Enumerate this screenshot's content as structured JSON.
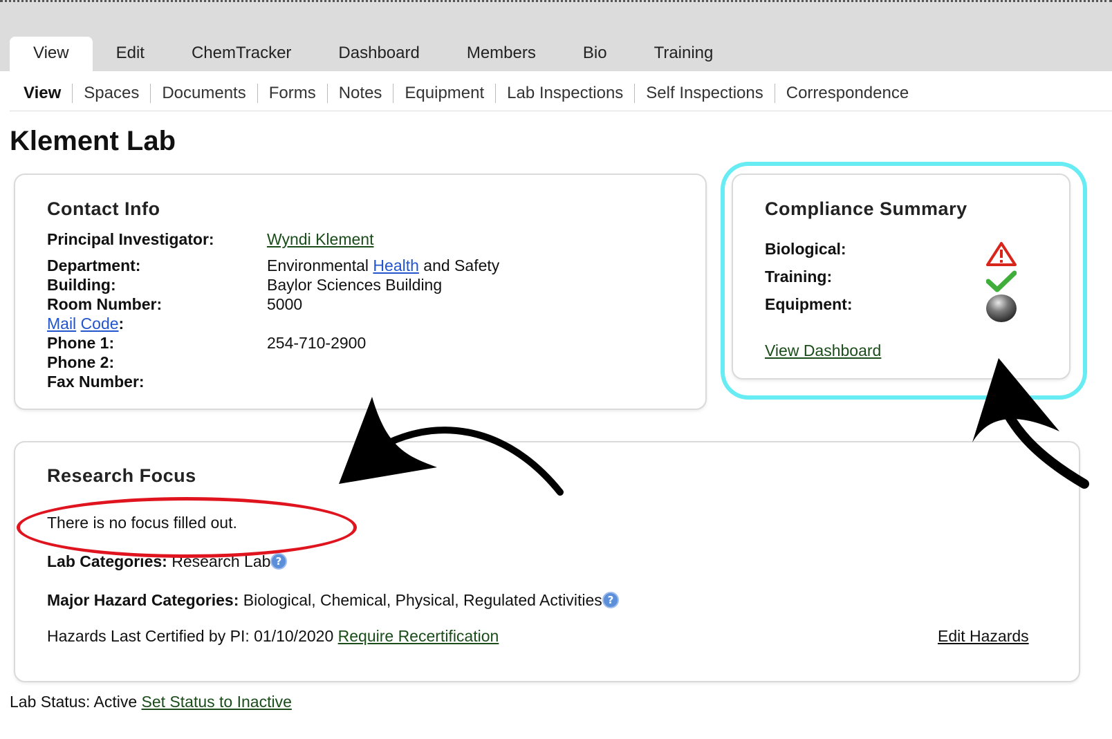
{
  "tabs": [
    {
      "label": "View",
      "active": true
    },
    {
      "label": "Edit"
    },
    {
      "label": "ChemTracker"
    },
    {
      "label": "Dashboard"
    },
    {
      "label": "Members"
    },
    {
      "label": "Bio"
    },
    {
      "label": "Training"
    }
  ],
  "subnav": [
    "View",
    "Spaces",
    "Documents",
    "Forms",
    "Notes",
    "Equipment",
    "Lab Inspections",
    "Self Inspections",
    "Correspondence"
  ],
  "page_title": "Klement Lab",
  "contact": {
    "title": "Contact Info",
    "pi_label": "Principal Investigator:",
    "pi_value": "Wyndi Klement",
    "department_label": "Department:",
    "department_value_1": "Environmental",
    "department_value_link": "Health",
    "department_value_2": "and Safety",
    "building_label": "Building:",
    "building_value": "Baylor Sciences Building",
    "room_label": "Room Number:",
    "room_value": "5000",
    "mail_label_1": "Mail",
    "mail_label_2": "Code",
    "mail_colon": ":",
    "phone1_label": "Phone 1:",
    "phone1_value": "254-710-2900",
    "phone2_label": "Phone 2:",
    "fax_label": "Fax Number:"
  },
  "compliance": {
    "title": "Compliance Summary",
    "biological_label": "Biological:",
    "biological_status": "warning-icon",
    "training_label": "Training:",
    "training_status": "check-icon",
    "equipment_label": "Equipment:",
    "equipment_status": "grey-circle-icon",
    "view_dashboard": "View Dashboard"
  },
  "research": {
    "title": "Research Focus",
    "focus_text": "There is no focus filled out.",
    "lab_categories_label": "Lab Categories:",
    "lab_categories_value": "Research Lab",
    "hazard_label": "Major Hazard Categories:",
    "hazard_value": "Biological, Chemical, Physical, Regulated Activities",
    "certified_text": "Hazards Last Certified by PI: 01/10/2020",
    "recertify_link": "Require Recertification",
    "edit_hazards": "Edit Hazards"
  },
  "lab_status": {
    "text": "Lab Status: Active",
    "link": "Set Status to Inactive"
  },
  "annotation_colors": {
    "highlight_box": "#66ecf2",
    "highlight_ellipse": "#e0141e",
    "arrows": "#000000"
  }
}
